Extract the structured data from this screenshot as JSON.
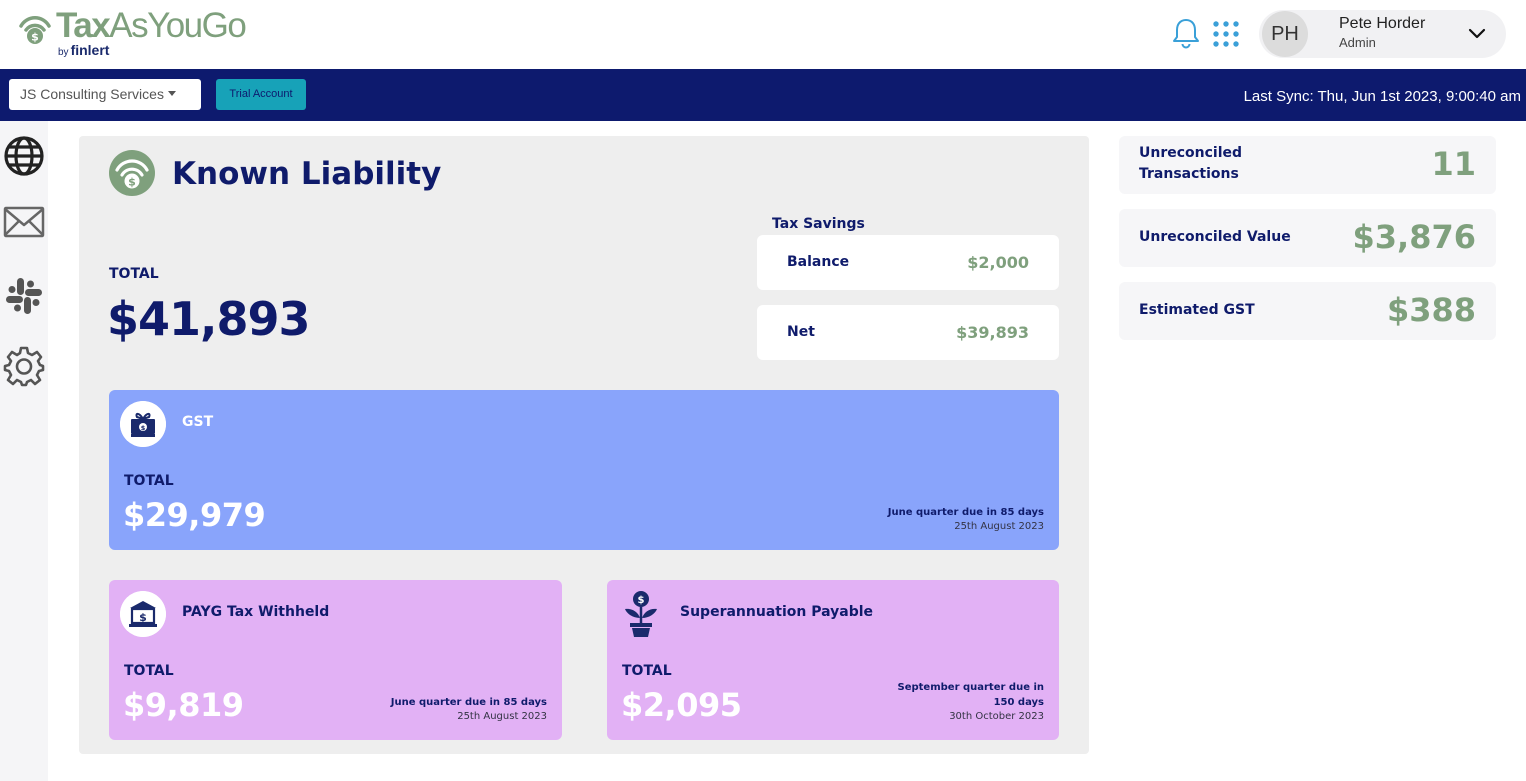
{
  "brand": {
    "name_part1": "Tax",
    "name_part2": "AsYouGo",
    "by": "by",
    "company": "finlert",
    "color": "#7fa07d"
  },
  "header": {
    "icons": [
      "bell-icon",
      "apps-grid-icon",
      "chevron-down-icon"
    ],
    "user": {
      "initials": "PH",
      "name": "Pete Horder",
      "role": "Admin"
    }
  },
  "navbar": {
    "company_select": "JS Consulting Services",
    "trial_label": "Trial Account",
    "last_sync": "Last Sync: Thu, Jun 1st 2023, 9:00:40 am",
    "background": "#0d1a6e"
  },
  "sidebar": {
    "items": [
      {
        "icon": "globe-icon"
      },
      {
        "icon": "mail-icon"
      },
      {
        "icon": "slack-icon"
      },
      {
        "icon": "gear-icon"
      }
    ]
  },
  "liability": {
    "title": "Known Liability",
    "total_label": "TOTAL",
    "total_value": "$41,893",
    "tax_savings": {
      "label": "Tax Savings",
      "balance_label": "Balance",
      "balance_value": "$2,000",
      "net_label": "Net",
      "net_value": "$39,893"
    },
    "gst": {
      "name": "GST",
      "total_label": "TOTAL",
      "total_value": "$29,979",
      "due": "June quarter due in 85 days",
      "due_date": "25th August 2023",
      "color": "#89a4fb"
    },
    "payg": {
      "name": "PAYG Tax Withheld",
      "total_label": "TOTAL",
      "total_value": "$9,819",
      "due": "June quarter due in 85 days",
      "due_date": "25th August 2023",
      "color": "#e2b1f5"
    },
    "super": {
      "name": "Superannuation Payable",
      "total_label": "TOTAL",
      "total_value": "$2,095",
      "due_line1": "September quarter due in",
      "due_line2": "150 days",
      "due_date": "30th October 2023",
      "color": "#e2b1f5"
    }
  },
  "stats": {
    "unreconciled_transactions_line1": "Unreconciled",
    "unreconciled_transactions_line2": "Transactions",
    "unreconciled_transactions_value": "11",
    "unreconciled_value_label": "Unreconciled Value",
    "unreconciled_value": "$3,876",
    "estimated_gst_label": "Estimated GST",
    "estimated_gst_value": "$388"
  }
}
